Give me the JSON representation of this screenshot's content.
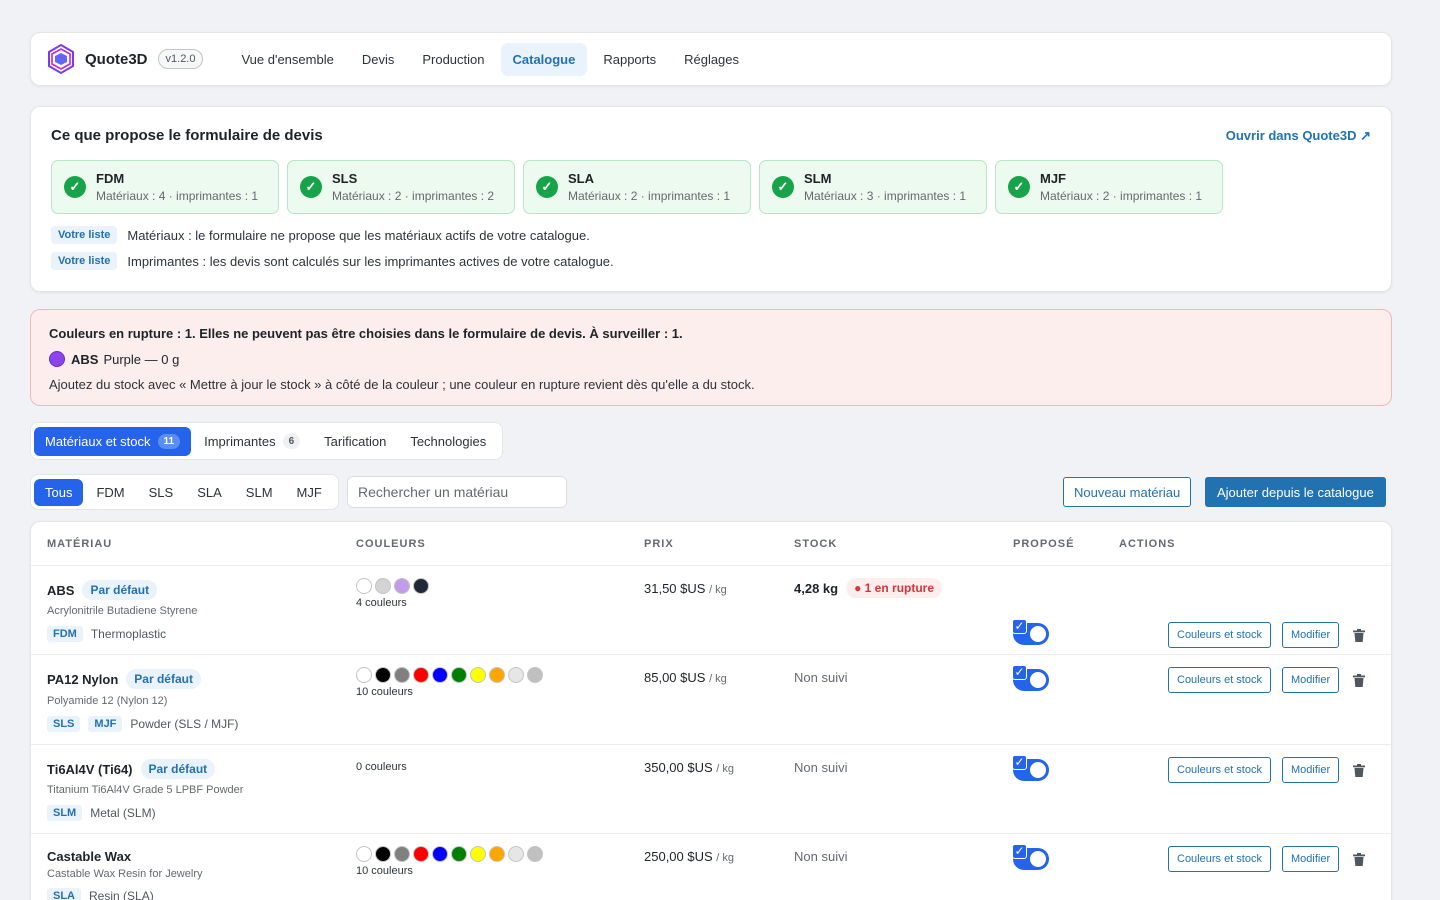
{
  "app": {
    "name": "Quote3D",
    "version": "v1.2.0"
  },
  "nav": [
    "Vue d'ensemble",
    "Devis",
    "Production",
    "Catalogue",
    "Rapports",
    "Réglages"
  ],
  "form": {
    "title": "Ce que propose le formulaire de devis",
    "open_link": "Ouvrir dans Quote3D ↗",
    "technologies": [
      {
        "name": "FDM",
        "meta": "Matériaux : 4 · imprimantes : 1"
      },
      {
        "name": "SLS",
        "meta": "Matériaux : 2 · imprimantes : 2"
      },
      {
        "name": "SLA",
        "meta": "Matériaux : 2 · imprimantes : 1"
      },
      {
        "name": "SLM",
        "meta": "Matériaux : 3 · imprimantes : 1"
      },
      {
        "name": "MJF",
        "meta": "Matériaux : 2 · imprimantes : 1"
      }
    ],
    "notes": [
      {
        "tag": "Votre liste",
        "text": "Matériaux : le formulaire ne propose que les matériaux actifs de votre catalogue."
      },
      {
        "tag": "Votre liste",
        "text": "Imprimantes : les devis sont calculés sur les imprimantes actives de votre catalogue."
      }
    ]
  },
  "alert": {
    "title": "Couleurs en rupture : 1. Elles ne peuvent pas être choisies dans le formulaire de devis. À surveiller : 1.",
    "item_material": "ABS",
    "item_detail": "Purple — 0 g",
    "message": "Ajoutez du stock avec « Mettre à jour le stock » à côté de la couleur ; une couleur en rupture revient dès qu'elle a du stock."
  },
  "tabs": [
    {
      "label": "Matériaux et stock",
      "count": "11"
    },
    {
      "label": "Imprimantes",
      "count": "6"
    },
    {
      "label": "Tarification",
      "count": ""
    },
    {
      "label": "Technologies",
      "count": ""
    }
  ],
  "filters": [
    "Tous",
    "FDM",
    "SLS",
    "SLA",
    "SLM",
    "MJF"
  ],
  "search_placeholder": "Rechercher un matériau",
  "buttons": {
    "new_material": "Nouveau matériau",
    "add_from_catalog": "Ajouter depuis le catalogue"
  },
  "table": {
    "headers": [
      "MATÉRIAU",
      "COULEURS",
      "PRIX",
      "STOCK",
      "PROPOSÉ",
      "ACTIONS"
    ],
    "default_label": "Par défaut",
    "action_colors": "Couleurs et stock",
    "action_edit": "Modifier",
    "rows": [
      {
        "name": "ABS",
        "is_default": true,
        "desc": "Acrylonitrile Butadiene Styrene",
        "tags": [
          "FDM"
        ],
        "category": "Thermoplastic",
        "colors": [
          "#ffffff",
          "#d4d4d4",
          "#c39be8",
          "#1f2937"
        ],
        "color_count": "4 couleurs",
        "price": "31,50 $US",
        "unit": "/ kg",
        "stock": "4,28 kg",
        "stock_alert": "● 1 en rupture",
        "proposed": true
      },
      {
        "name": "PA12 Nylon",
        "is_default": true,
        "desc": "Polyamide 12 (Nylon 12)",
        "tags": [
          "SLS",
          "MJF"
        ],
        "category": "Powder (SLS / MJF)",
        "colors": [
          "#ffffff",
          "#000000",
          "#808080",
          "#ff0000",
          "#0000ff",
          "#008000",
          "#ffff00",
          "#ffa500",
          "#e6e6e6",
          "#c0c0c0"
        ],
        "color_count": "10 couleurs",
        "price": "85,00 $US",
        "unit": "/ kg",
        "stock": "Non suivi",
        "stock_alert": "",
        "proposed": true
      },
      {
        "name": "Ti6Al4V (Ti64)",
        "is_default": true,
        "desc": "Titanium Ti6Al4V Grade 5 LPBF Powder",
        "tags": [
          "SLM"
        ],
        "category": "Metal (SLM)",
        "colors": [],
        "color_count": "0 couleurs",
        "price": "350,00 $US",
        "unit": "/ kg",
        "stock": "Non suivi",
        "stock_alert": "",
        "proposed": true
      },
      {
        "name": "Castable Wax",
        "is_default": false,
        "desc": "Castable Wax Resin for Jewelry",
        "tags": [
          "SLA"
        ],
        "category": "Resin (SLA)",
        "colors": [
          "#ffffff",
          "#000000",
          "#808080",
          "#ff0000",
          "#0000ff",
          "#008000",
          "#ffff00",
          "#ffa500",
          "#e6e6e6",
          "#c0c0c0"
        ],
        "color_count": "10 couleurs",
        "price": "250,00 $US",
        "unit": "/ kg",
        "stock": "Non suivi",
        "stock_alert": "",
        "proposed": true
      }
    ]
  }
}
